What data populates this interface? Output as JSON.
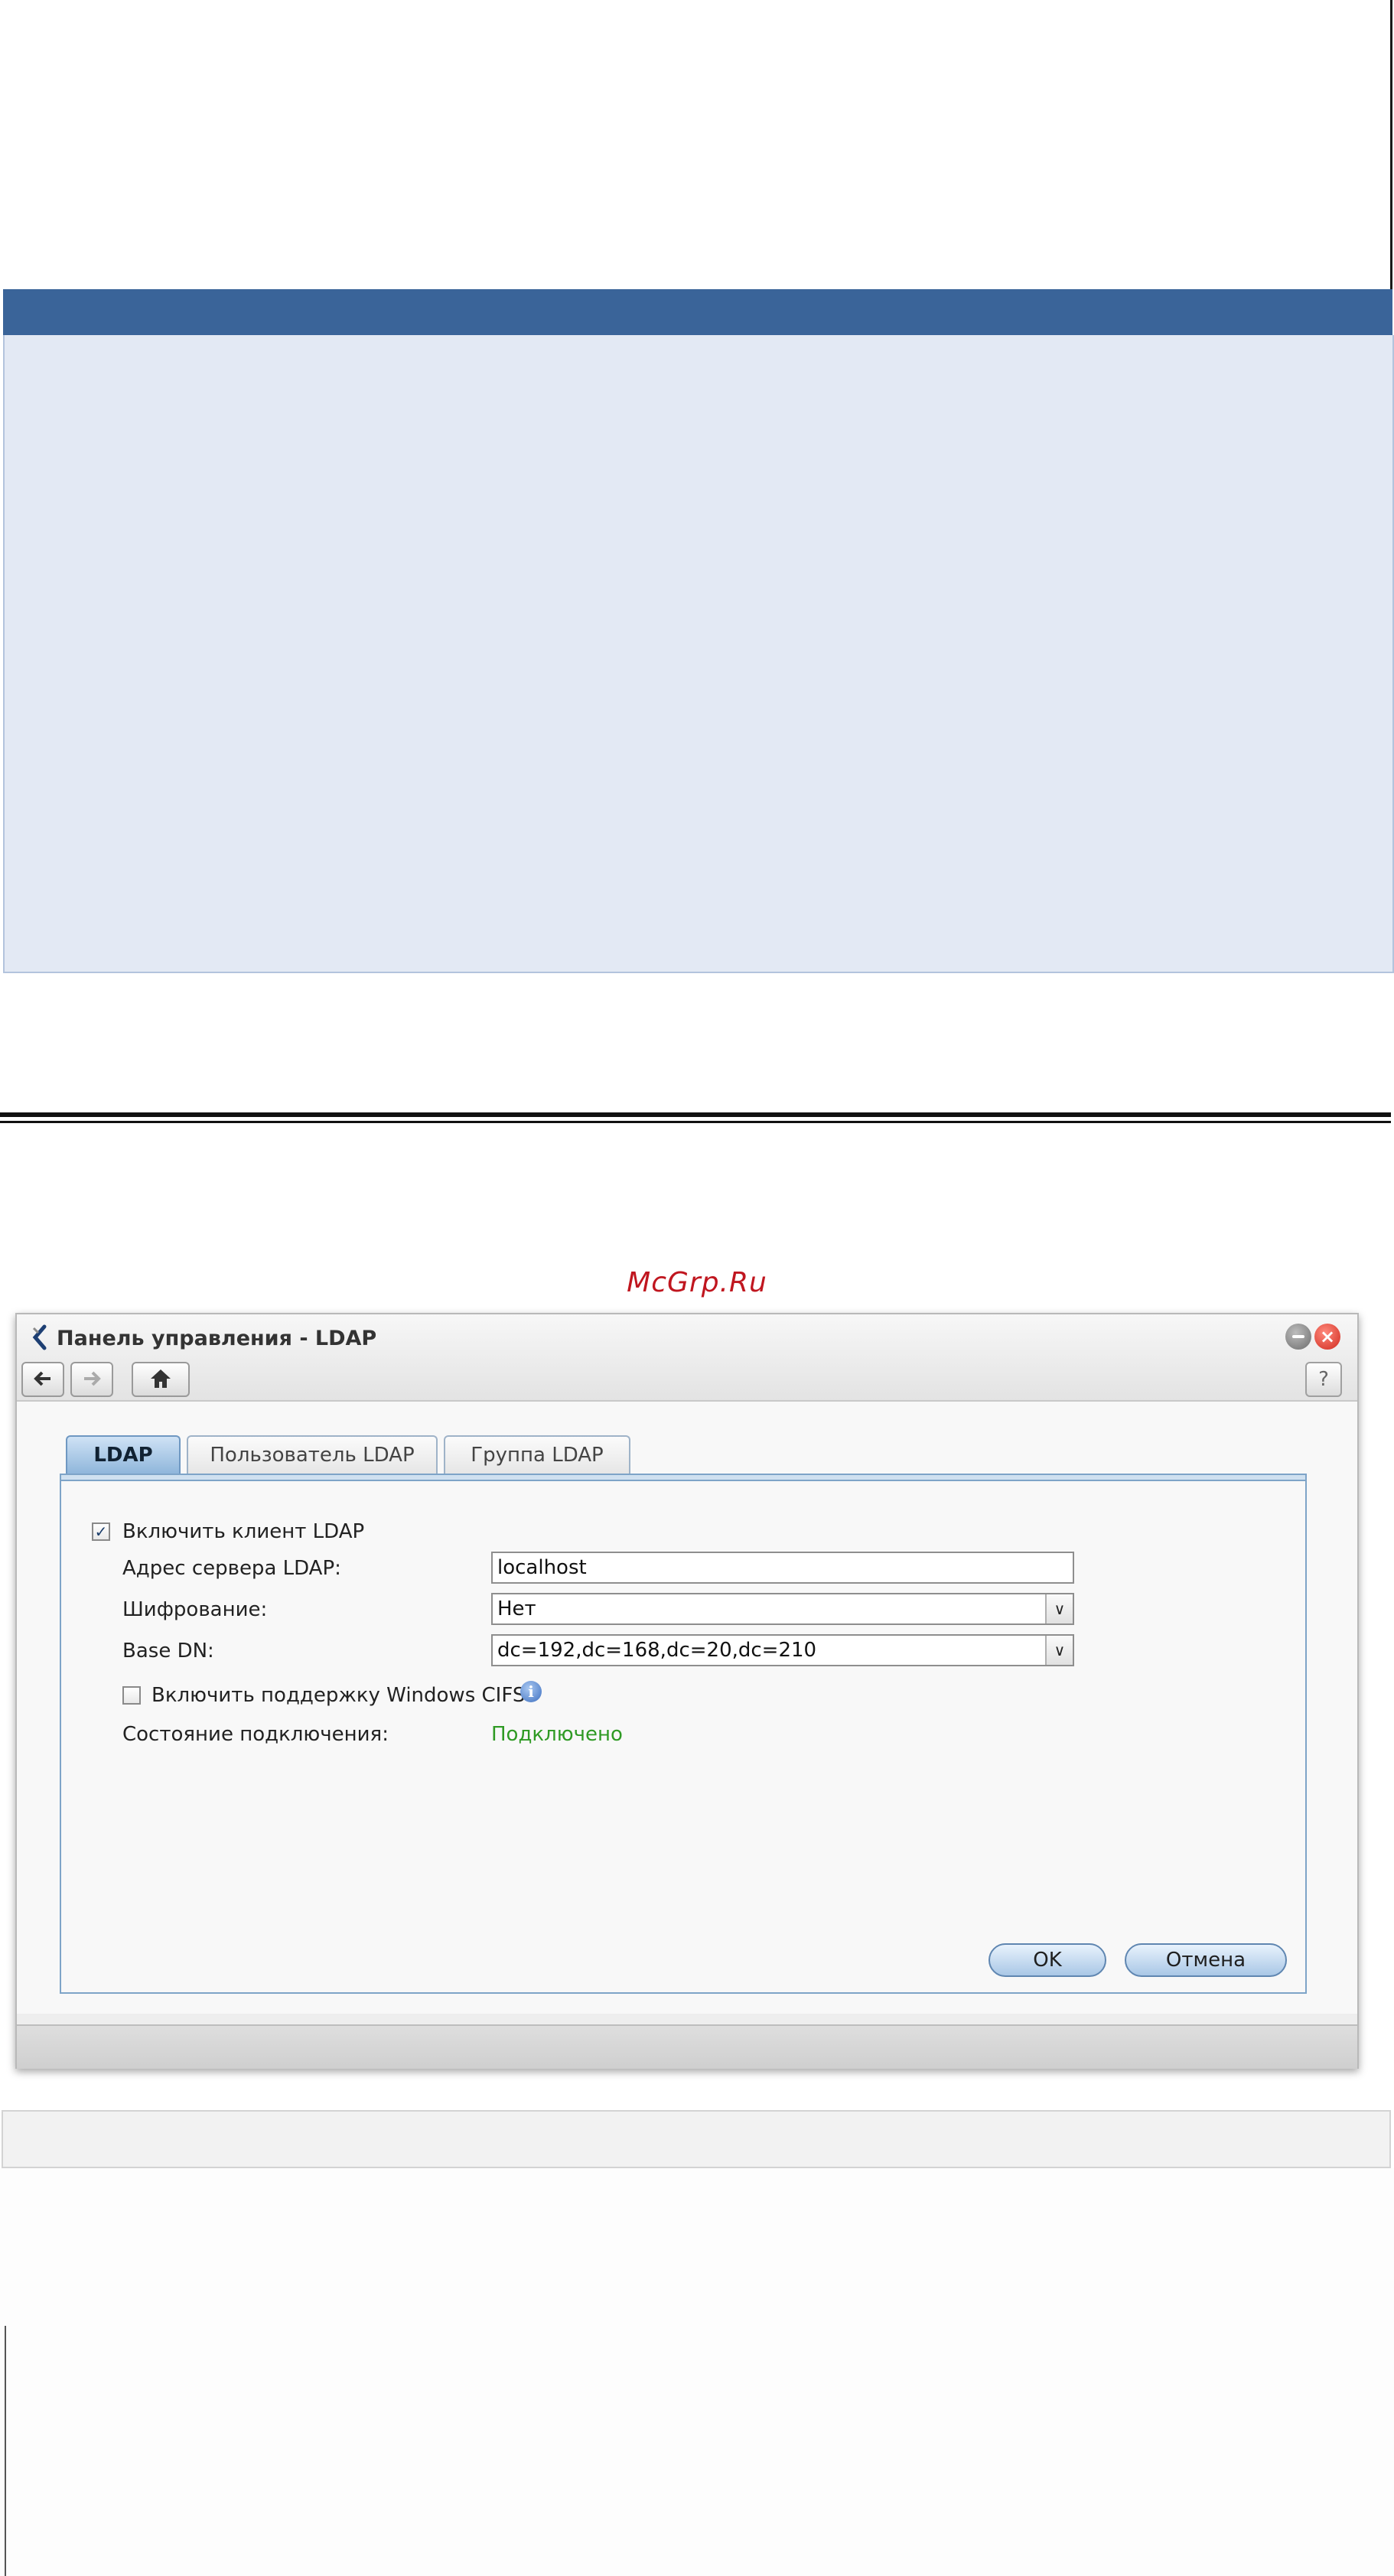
{
  "watermark": "McGrp.Ru",
  "window": {
    "title": "Панель управления - LDAP",
    "close_glyph": "×",
    "help_glyph": "?",
    "icons": {
      "app": "control-panel-icon",
      "back": "arrow-left-icon",
      "forward": "arrow-right-icon",
      "home": "home-icon",
      "minimize": "minimize-icon",
      "close": "close-icon",
      "info": "info-icon"
    }
  },
  "tabs": [
    {
      "label": "LDAP",
      "active": true
    },
    {
      "label": "Пользователь LDAP",
      "active": false
    },
    {
      "label": "Группа LDAP",
      "active": false
    }
  ],
  "form": {
    "enable_ldap_label": "Включить клиент LDAP",
    "enable_ldap_checked": true,
    "server_label": "Адрес сервера LDAP:",
    "server_value": "localhost",
    "encryption_label": "Шифрование:",
    "encryption_value": "Нет",
    "base_dn_label": "Base DN:",
    "base_dn_value": "dc=192,dc=168,dc=20,dc=210",
    "cifs_label": "Включить поддержку Windows CIFS",
    "cifs_checked": false,
    "status_label": "Состояние подключения:",
    "status_value": "Подключено"
  },
  "buttons": {
    "ok": "OK",
    "cancel": "Отмена"
  },
  "colors": {
    "header_blue": "#3a6499",
    "panel_blue": "#e3e9f4",
    "status_green": "#2f9a24",
    "watermark_red": "#c0161f"
  }
}
